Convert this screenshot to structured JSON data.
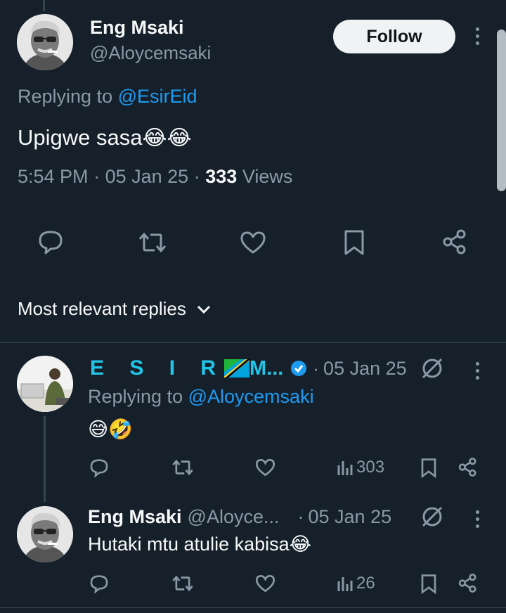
{
  "main_tweet": {
    "author_name": "Eng Msaki",
    "author_handle": "@Aloycemsaki",
    "follow_label": "Follow",
    "replying_prefix": "Replying to",
    "replying_to": "@EsirEid",
    "text": "Upigwe sasa",
    "time": "5:54 PM",
    "date": "05 Jan 25",
    "views_count": "333",
    "views_label": "Views"
  },
  "replies_sort": {
    "label": "Most relevant replies"
  },
  "reply1": {
    "author_name": "E S I R",
    "author_suffix": "M...",
    "date": "05 Jan 25",
    "replying_prefix": "Replying to",
    "replying_to": "@Aloycemsaki",
    "views": "303"
  },
  "reply2": {
    "author_name": "Eng Msaki",
    "author_handle": "@Aloyce...",
    "date": "05 Jan 25",
    "text": "Hutaki mtu atulie kabisa",
    "views": "26"
  },
  "colors": {
    "background": "#15202b",
    "accent": "#1d9bf0",
    "muted": "#8b98a5",
    "cyan_name": "#22c5e8"
  },
  "icons": [
    "reply-icon",
    "retweet-icon",
    "like-icon",
    "bookmark-icon",
    "share-icon",
    "views-icon",
    "verified-icon",
    "grok-icon",
    "more-icon",
    "chevron-down-icon"
  ]
}
